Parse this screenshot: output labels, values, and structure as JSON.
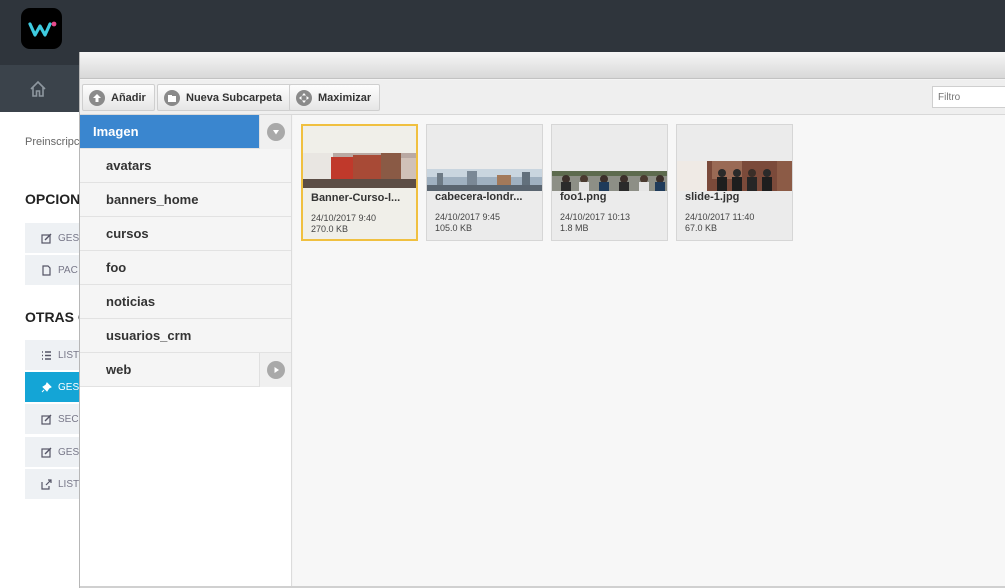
{
  "app": {
    "breadcrumb": "Preinscripc",
    "sections": [
      {
        "title": "OPCIONES"
      },
      {
        "title": "OTRAS OP"
      }
    ],
    "menu_group1": [
      {
        "label": "GES",
        "icon": "edit-icon"
      },
      {
        "label": "PAC",
        "icon": "document-icon"
      }
    ],
    "menu_group2": [
      {
        "label": "LIST",
        "icon": "list-icon"
      },
      {
        "label": "GES",
        "icon": "pin-icon"
      },
      {
        "label": "SEC",
        "icon": "edit-icon"
      },
      {
        "label": "GES",
        "icon": "edit-icon"
      },
      {
        "label": "LIST",
        "icon": "external-link-icon"
      }
    ],
    "active_color": "#14a5d6"
  },
  "toolbar": {
    "add_label": "Añadir",
    "new_subfolder_label": "Nueva Subcarpeta",
    "maximize_label": "Maximizar",
    "filter_placeholder": "Filtro"
  },
  "tree": {
    "root": "Imagen",
    "folders": [
      "avatars",
      "banners_home",
      "cursos",
      "foo",
      "noticias",
      "usuarios_crm",
      "web"
    ]
  },
  "files": [
    {
      "name": "Banner-Curso-l...",
      "date": "24/10/2017 9:40",
      "size": "270.0 KB"
    },
    {
      "name": "cabecera-londr...",
      "date": "24/10/2017 9:45",
      "size": "105.0 KB"
    },
    {
      "name": "foo1.png",
      "date": "24/10/2017 10:13",
      "size": "1.8 MB"
    },
    {
      "name": "slide-1.jpg",
      "date": "24/10/2017 11:40",
      "size": "67.0 KB"
    }
  ],
  "colors": {
    "selected_folder": "#3a86cf",
    "selected_file_border": "#f0c040"
  }
}
